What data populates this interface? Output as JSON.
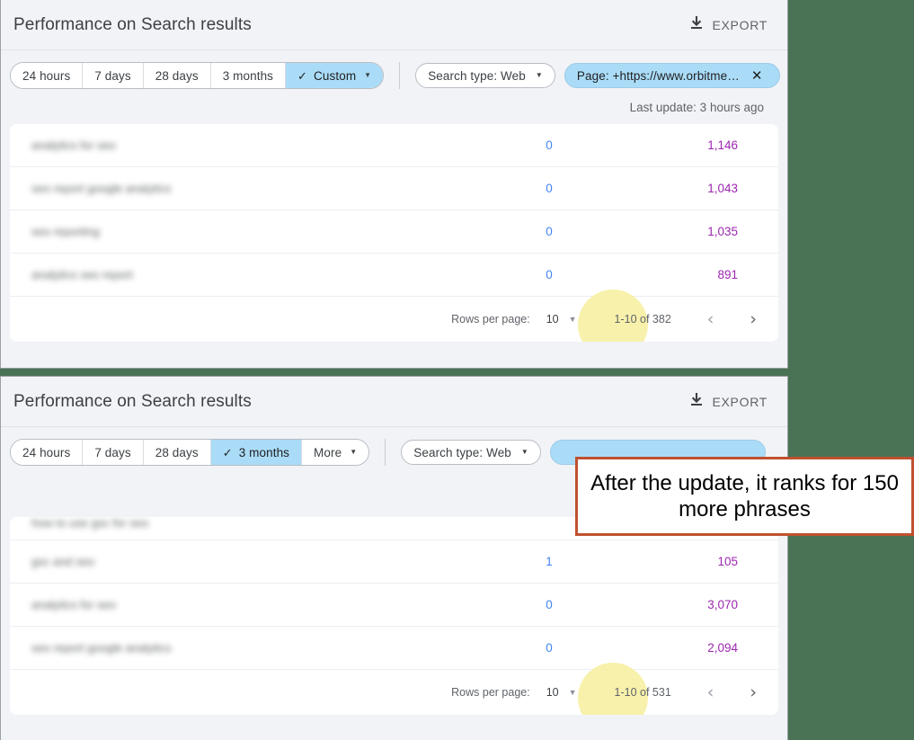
{
  "panels": [
    {
      "title": "Performance on Search results",
      "export_label": "EXPORT",
      "export_icon": "download-icon",
      "date_segments": [
        {
          "label": "24 hours",
          "active": false,
          "check": false,
          "caret": false
        },
        {
          "label": "7 days",
          "active": false,
          "check": false,
          "caret": false
        },
        {
          "label": "28 days",
          "active": false,
          "check": false,
          "caret": false
        },
        {
          "label": "3 months",
          "active": false,
          "check": false,
          "caret": false
        },
        {
          "label": "Custom",
          "active": true,
          "check": true,
          "caret": true
        }
      ],
      "search_type_chip": {
        "label": "Search type: Web",
        "caret": "▼"
      },
      "page_chip": {
        "label": "Page: +https://www.orbitme…",
        "close": "✕"
      },
      "last_update": "Last update: 3 hours ago",
      "rows": [
        {
          "query": "analytics for seo",
          "clicks": "0",
          "impressions": "1,146"
        },
        {
          "query": "seo report google analytics",
          "clicks": "0",
          "impressions": "1,043"
        },
        {
          "query": "seo reporting",
          "clicks": "0",
          "impressions": "1,035"
        },
        {
          "query": "analytics seo report",
          "clicks": "0",
          "impressions": "891"
        }
      ],
      "pager": {
        "rows_per_page_label": "Rows per page:",
        "rows_per_page_value": "10",
        "range": "1-10 of 382",
        "prev_icon": "‹",
        "next_icon": "›"
      }
    },
    {
      "title": "Performance on Search results",
      "export_label": "EXPORT",
      "export_icon": "download-icon",
      "date_segments": [
        {
          "label": "24 hours",
          "active": false,
          "check": false,
          "caret": false
        },
        {
          "label": "7 days",
          "active": false,
          "check": false,
          "caret": false
        },
        {
          "label": "28 days",
          "active": false,
          "check": false,
          "caret": false
        },
        {
          "label": "3 months",
          "active": true,
          "check": true,
          "caret": false
        },
        {
          "label": "More",
          "active": false,
          "check": false,
          "caret": true
        }
      ],
      "search_type_chip": {
        "label": "Search type: Web",
        "caret": "▼"
      },
      "page_chip": {
        "label": "",
        "close": ""
      },
      "last_update": "",
      "rows": [
        {
          "query": "how to use gsc for seo",
          "clicks": "",
          "impressions": ""
        },
        {
          "query": "gsc and seo",
          "clicks": "1",
          "impressions": "105"
        },
        {
          "query": "analytics for seo",
          "clicks": "0",
          "impressions": "3,070"
        },
        {
          "query": "seo report google analytics",
          "clicks": "0",
          "impressions": "2,094"
        }
      ],
      "pager": {
        "rows_per_page_label": "Rows per page:",
        "rows_per_page_value": "10",
        "range": "1-10 of 531",
        "prev_icon": "‹",
        "next_icon": "›"
      }
    }
  ],
  "callout": {
    "text": "After the update, it ranks for 150 more phrases",
    "border_color": "#c0512f"
  },
  "colors": {
    "background": "#4a7254",
    "panel_bg": "#f1f3f7",
    "accent_selected": "#aadcf7",
    "clicks": "#4285f4",
    "impressions": "#9c27b0",
    "highlight": "#f7ef9e"
  }
}
